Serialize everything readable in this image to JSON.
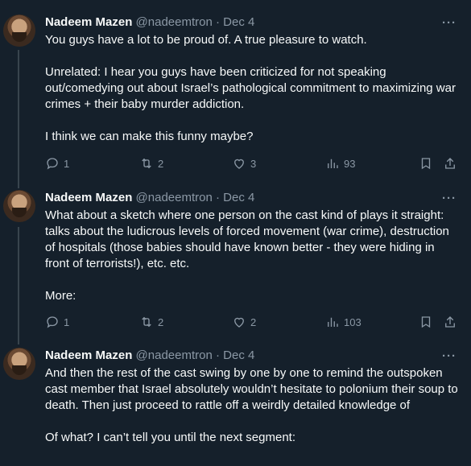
{
  "tweets": [
    {
      "name": "Nadeem Mazen",
      "handle": "@nadeemtron",
      "sep": "·",
      "date": "Dec 4",
      "more": "···",
      "text": "You guys have a lot to be proud of. A true pleasure to watch.\n\nUnrelated: I hear you guys have been criticized for not speaking out/comedying out about Israel’s pathological commitment to maximizing war crimes + their baby murder addiction.\n\nI think we can make this funny maybe?",
      "replies": "1",
      "retweets": "2",
      "likes": "3",
      "views": "93"
    },
    {
      "name": "Nadeem Mazen",
      "handle": "@nadeemtron",
      "sep": "·",
      "date": "Dec 4",
      "more": "···",
      "text": "What about a sketch where one person on the cast kind of plays it straight: talks about the ludicrous levels of forced movement (war crime), destruction of hospitals (those babies should have known better - they were hiding in front of terrorists!), etc. etc.\n\nMore:",
      "replies": "1",
      "retweets": "2",
      "likes": "2",
      "views": "103"
    },
    {
      "name": "Nadeem Mazen",
      "handle": "@nadeemtron",
      "sep": "·",
      "date": "Dec 4",
      "more": "···",
      "text": "And then the rest of the cast swing by one by one to remind the outspoken cast member that Israel absolutely wouldn’t hesitate to polonium their soup to death. Then just proceed to rattle off a weirdly detailed knowledge of\n\nOf what? I can’t tell you until the next segment:"
    }
  ]
}
